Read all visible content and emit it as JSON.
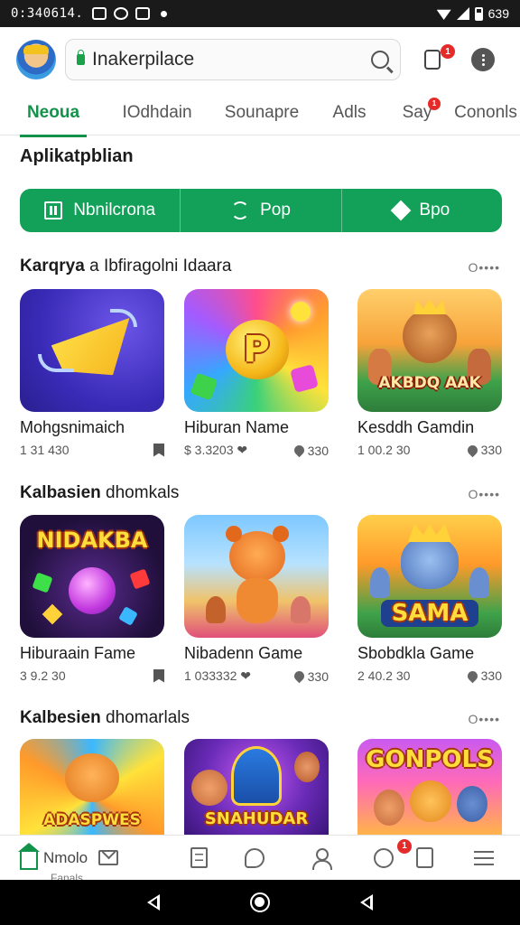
{
  "status_bar": {
    "time": "0:340614.",
    "right_text": "639"
  },
  "header": {
    "search_value": "Inakerpilace",
    "notification_count": "1"
  },
  "tabs": [
    {
      "label": "Neoua",
      "active": true
    },
    {
      "label": "IOdhdain",
      "active": false
    },
    {
      "label": "Sounapre",
      "active": false
    },
    {
      "label": "Adls",
      "active": false
    },
    {
      "label": "Say",
      "active": false,
      "badge": "1"
    },
    {
      "label": "Cononls",
      "active": false
    }
  ],
  "section": {
    "title": "Aplikatpblian"
  },
  "segments": [
    {
      "label": "Nbnilcrona",
      "icon": "grid-icon"
    },
    {
      "label": "Pop",
      "icon": "swap-icon"
    },
    {
      "label": "Bpo",
      "icon": "diamond-icon"
    }
  ],
  "rows": [
    {
      "title_bold": "Karqrya",
      "title_rest": " a Ibfiragolni Idaara",
      "more": "O••••",
      "apps": [
        {
          "name": "Mohgsnimaich",
          "meta": "1 31 430",
          "right_icon": "bookmark-icon",
          "right_text": ""
        },
        {
          "name": "Hiburan Name",
          "meta": "$ 3.3203 ❤",
          "right_icon": "pin-icon",
          "right_text": "330"
        },
        {
          "name": "Kesddh Gamdin",
          "meta": "1 00.2 30",
          "right_icon": "pin-icon",
          "right_text": "330"
        }
      ]
    },
    {
      "title_bold": "Kalbasien",
      "title_rest": " dhomkals",
      "more": "O••••",
      "apps": [
        {
          "name": "Hiburaain Fame",
          "meta": "3 9.2 30",
          "right_icon": "bookmark-icon",
          "right_text": ""
        },
        {
          "name": "Nibadenn Game",
          "meta": "1 033332 ❤",
          "right_icon": "pin-icon",
          "right_text": "330"
        },
        {
          "name": "Sbobdkla Game",
          "meta": "2 40.2 30",
          "right_icon": "pin-icon",
          "right_text": "330"
        }
      ]
    },
    {
      "title_bold": "Kalbesien",
      "title_rest": " dhomarlals",
      "more": "O••••",
      "apps": [
        {
          "name": "",
          "meta": ""
        },
        {
          "name": "",
          "meta": ""
        },
        {
          "name": "",
          "meta": ""
        }
      ]
    }
  ],
  "art_texts": {
    "r2c1": "NIDAKBA",
    "r2c3": "SAMA",
    "r1c3": "AKBDQ AAK",
    "r3c1": "ADASPWES",
    "r3c2": "SNAHUDAR",
    "r3c3": "GONPOLS"
  },
  "bottom_nav": {
    "home_label": "Nmolo",
    "home_sub": "Fanals",
    "badge": "1"
  },
  "colors": {
    "accent_green": "#13a15a",
    "badge_red": "#e52a2a"
  }
}
